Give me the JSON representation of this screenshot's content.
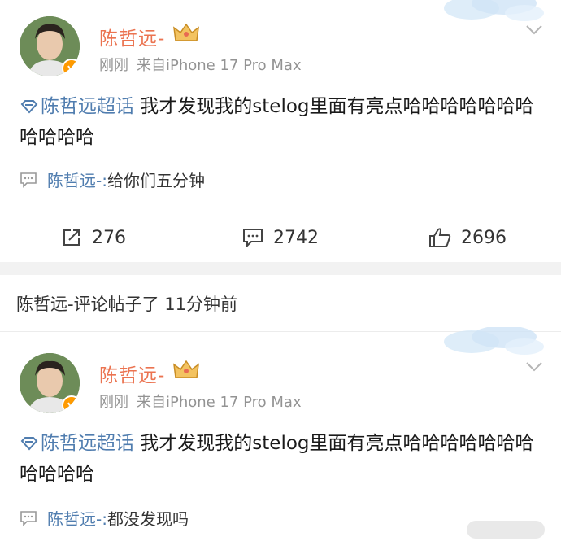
{
  "posts": [
    {
      "author": "陈哲远-",
      "time": "刚刚",
      "source": "来自iPhone 17 Pro Max",
      "topic": "陈哲远超话",
      "text": " 我才发现我的stelog里面有亮点哈哈哈哈哈哈哈哈哈哈哈",
      "comment_author": "陈哲远-:",
      "comment_text": " 给你们五分钟",
      "reposts": "276",
      "comments": "2742",
      "likes": "2696"
    },
    {
      "author": "陈哲远-",
      "time": "刚刚",
      "source": "来自iPhone 17 Pro Max",
      "topic": "陈哲远超话",
      "text": " 我才发现我的stelog里面有亮点哈哈哈哈哈哈哈哈哈哈哈",
      "comment_author": "陈哲远-:",
      "comment_text": " 都没发现吗"
    }
  ],
  "activity_line": "陈哲远-评论帖子了 11分钟前",
  "colors": {
    "author": "#eb7350",
    "link": "#507daf",
    "meta": "#939393",
    "verified": "#ff9a00"
  },
  "icons": [
    "verified-badge-icon",
    "crown-icon",
    "chevron-down-icon",
    "topic-diamond-icon",
    "comment-icon",
    "repost-icon",
    "like-icon"
  ]
}
